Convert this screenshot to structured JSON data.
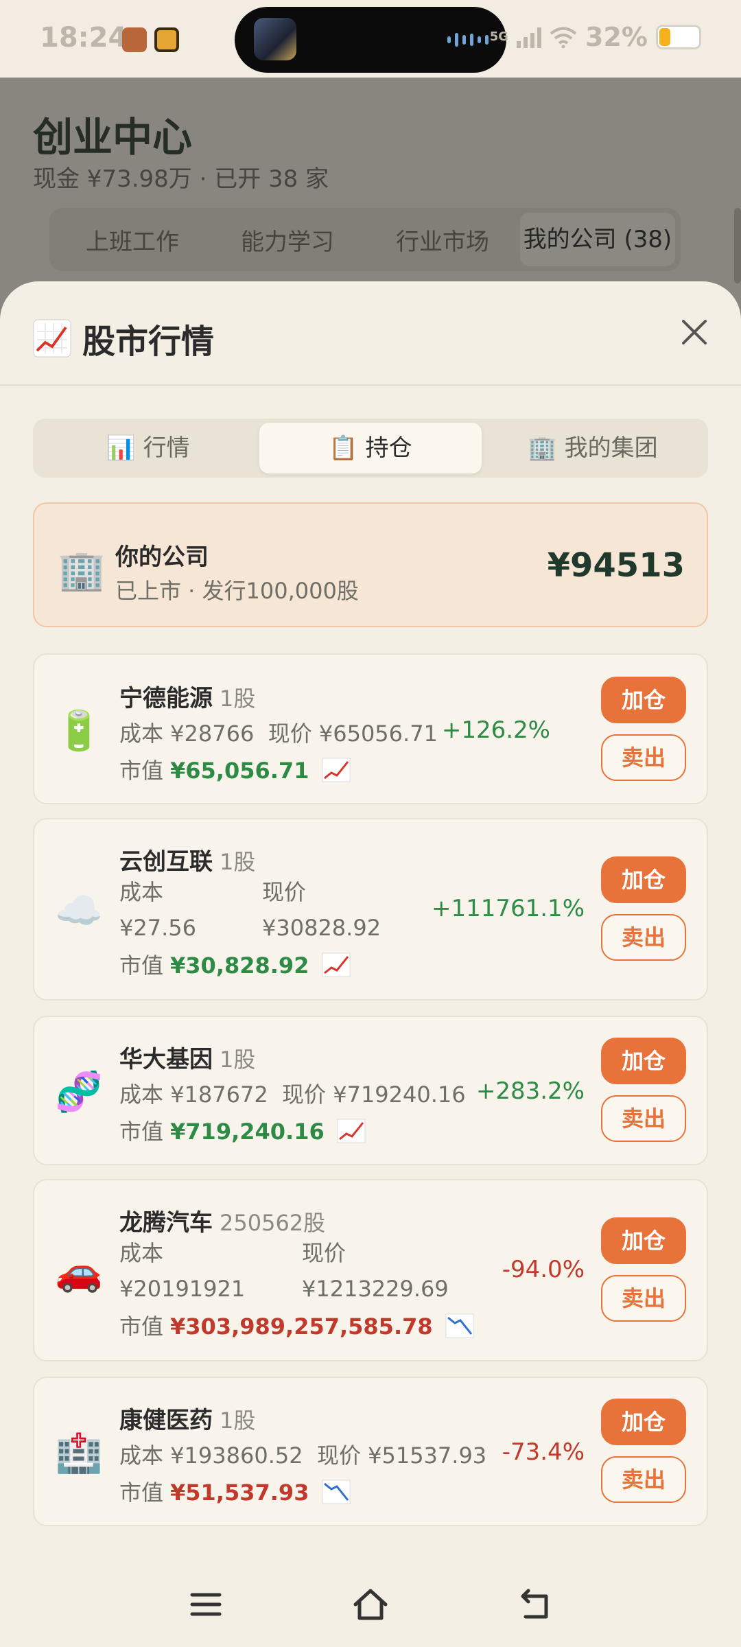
{
  "status_bar": {
    "time": "18:24",
    "signal_label": "5G",
    "battery": "32%"
  },
  "background": {
    "title": "创业中心",
    "subtitle": "现金 ¥73.98万 · 已开 38 家",
    "tabs": [
      {
        "label": "上班工作"
      },
      {
        "label": "能力学习"
      },
      {
        "label": "行业市场"
      },
      {
        "label": "我的公司 (38)"
      }
    ]
  },
  "sheet": {
    "title": "股市行情",
    "segments": [
      {
        "icon": "📊",
        "label": "行情"
      },
      {
        "icon": "📋",
        "label": "持仓"
      },
      {
        "icon": "🏢",
        "label": "我的集团"
      }
    ],
    "active_segment": "持仓",
    "company": {
      "icon": "🏢",
      "name": "你的公司",
      "sub": "已上市 · 发行100,000股",
      "value": "¥94513"
    },
    "buy_label": "加仓",
    "sell_label": "卖出",
    "market_value_label": "市值",
    "holdings": [
      {
        "icon": "🔋",
        "name": "宁德能源",
        "qty": "1股",
        "cost": "成本 ¥28766",
        "price": "现价 ¥65056.71",
        "change": "+126.2%",
        "market_value": "¥65,056.71",
        "trend": "up"
      },
      {
        "icon": "☁️",
        "name": "云创互联",
        "qty": "1股",
        "cost_label": "成本",
        "cost_value": "¥27.56",
        "price_label": "现价",
        "price_value": "¥30828.92",
        "change": "+111761.1%",
        "market_value": "¥30,828.92",
        "trend": "up"
      },
      {
        "icon": "🧬",
        "name": "华大基因",
        "qty": "1股",
        "cost": "成本 ¥187672",
        "price": "现价 ¥719240.16",
        "change": "+283.2%",
        "market_value": "¥719,240.16",
        "trend": "up"
      },
      {
        "icon": "🚗",
        "name": "龙腾汽车",
        "qty": "250562股",
        "cost_label": "成本",
        "cost_value": "¥20191921",
        "price_label": "现价",
        "price_value": "¥1213229.69",
        "change": "-94.0%",
        "market_value": "¥303,989,257,585.78",
        "trend": "down"
      },
      {
        "icon": "🏥",
        "name": "康健医药",
        "qty": "1股",
        "cost": "成本 ¥193860.52",
        "price": "现价 ¥51537.93",
        "change": "-73.4%",
        "market_value": "¥51,537.93",
        "trend": "down"
      }
    ]
  },
  "colors": {
    "accent": "#e8733a",
    "up": "#2e8b45",
    "down": "#c0392b",
    "sheet_bg": "#f4efe4"
  }
}
